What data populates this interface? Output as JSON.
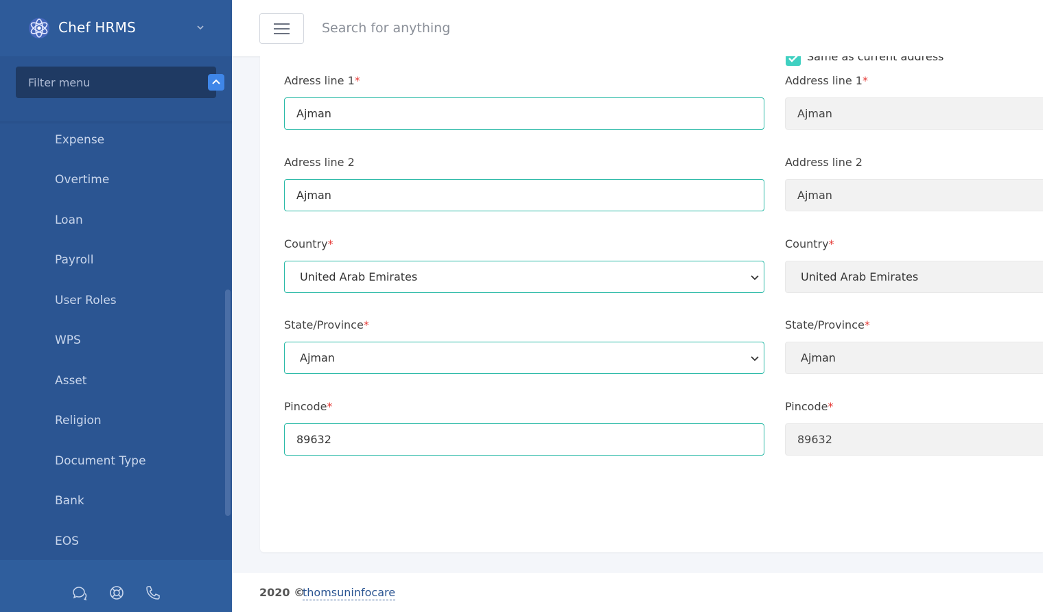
{
  "app": {
    "name": "Chef HRMS"
  },
  "sidebar": {
    "filter_placeholder": "Filter menu",
    "items": [
      {
        "label": "Expense"
      },
      {
        "label": "Overtime"
      },
      {
        "label": "Loan"
      },
      {
        "label": "Payroll"
      },
      {
        "label": "User Roles"
      },
      {
        "label": "WPS"
      },
      {
        "label": "Asset"
      },
      {
        "label": "Religion"
      },
      {
        "label": "Document Type"
      },
      {
        "label": "Bank"
      },
      {
        "label": "EOS"
      }
    ],
    "footer_icons": [
      "chat-icon",
      "lifebuoy-icon",
      "phone-icon"
    ]
  },
  "header": {
    "search_placeholder": "Search for anything"
  },
  "form": {
    "same_as_current_label": "Same as current address",
    "current": {
      "address1_label": "Adress line 1",
      "address1_value": "Ajman",
      "address2_label": "Adress line 2",
      "address2_value": "Ajman",
      "country_label": "Country",
      "country_value": "United Arab Emirates",
      "state_label": "State/Province",
      "state_value": "Ajman",
      "pincode_label": "Pincode",
      "pincode_value": "89632"
    },
    "permanent": {
      "address1_label": "Address line 1",
      "address1_value": "Ajman",
      "address2_label": "Address line 2",
      "address2_value": "Ajman",
      "country_label": "Country",
      "country_value": "United Arab Emirates",
      "state_label": "State/Province",
      "state_value": "Ajman",
      "pincode_label": "Pincode",
      "pincode_value": "89632"
    },
    "required_mark": "*"
  },
  "footer": {
    "copyright": "2020 ©",
    "link_text": "thomsuninfocare"
  },
  "colors": {
    "sidebar_bg": "#2b5592",
    "accent_teal": "#28b9a6",
    "required_red": "#e53935",
    "checkbox_teal": "#3fd0c1"
  }
}
